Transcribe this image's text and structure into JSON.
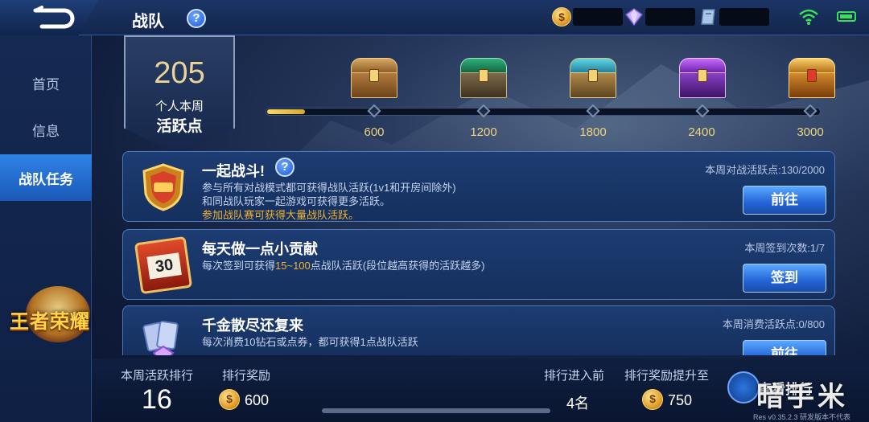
{
  "header": {
    "title": "战队",
    "help_glyph": "?",
    "currencies": [
      {
        "name": "gold-coin-icon",
        "value": ""
      },
      {
        "name": "diamond-icon",
        "value": ""
      },
      {
        "name": "voucher-icon",
        "value": ""
      }
    ]
  },
  "sidebar": {
    "items": [
      {
        "label": "首页",
        "active": false
      },
      {
        "label": "信息",
        "active": false
      },
      {
        "label": "战队任务",
        "active": true
      }
    ],
    "logo_text": "王者荣耀"
  },
  "weekly": {
    "points": "205",
    "label_line1": "个人本周",
    "label_line2": "活跃点",
    "progress_fraction": 0.068,
    "milestones": [
      "600",
      "1200",
      "1800",
      "2400",
      "3000"
    ]
  },
  "tasks": [
    {
      "title": "一起战斗!",
      "desc_line1": "参与所有对战模式都可获得战队活跃(1v1和开房间除外)",
      "desc_line2": "和同战队玩家一起游戏可获得更多活跃。",
      "desc_line3": "参加战队赛可获得大量战队活跃。",
      "progress": "本周对战活跃点:130/2000",
      "button": "前往"
    },
    {
      "title": "每天做一点小贡献",
      "desc_pre": "每次签到可获得",
      "desc_hl": "15~100",
      "desc_post": "点战队活跃(段位越高获得的活跃越多)",
      "progress": "本周签到次数:1/7",
      "button": "签到",
      "calendar_num": "30"
    },
    {
      "title": "千金散尽还复来",
      "desc_line1": "每次消费10钻石或点券，都可获得1点战队活跃",
      "progress": "本周消费活跃点:0/800",
      "button": "前往"
    }
  ],
  "bottom": {
    "rank_label": "本周活跃排行",
    "rank_value": "16",
    "reward_label": "排行奖励",
    "reward_value": "600",
    "top_label": "排行进入前",
    "top_value": "4名",
    "boost_label": "排行奖励提升至",
    "boost_value": "750",
    "view_button": "查看排行",
    "version": "Res v0.35.2.3  研发版本不代表",
    "watermark": "暗手米"
  },
  "colors": {
    "accent_blue": "#2f84e6",
    "gold_text": "#f1d47a",
    "highlight_orange": "#f1b32e"
  }
}
